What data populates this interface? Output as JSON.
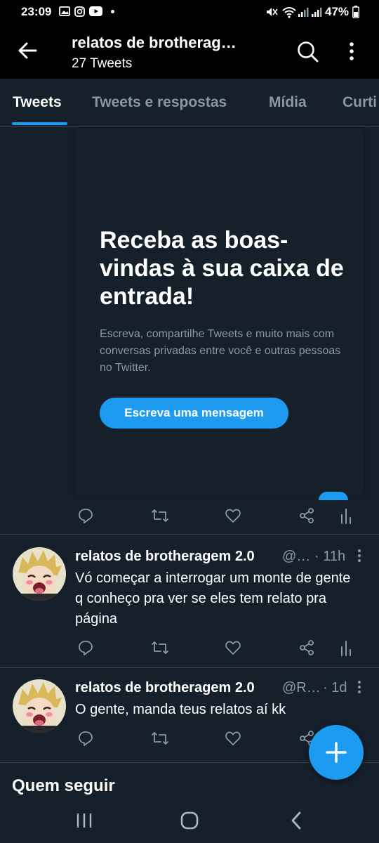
{
  "status_bar": {
    "time": "23:09",
    "battery": "47%",
    "left_icons": [
      "gallery-icon",
      "instagram-icon",
      "youtube-icon",
      "dot-icon"
    ],
    "right_icons": [
      "mute-icon",
      "wifi-icon",
      "signal-icon",
      "signal-icon",
      "battery-icon"
    ]
  },
  "header": {
    "title": "relatos de brotherag…",
    "subtitle": "27 Tweets",
    "icons": [
      "back-arrow-icon",
      "search-icon",
      "more-vertical-icon"
    ]
  },
  "tabs": [
    {
      "label": "Tweets",
      "active": true
    },
    {
      "label": "Tweets e respostas",
      "active": false
    },
    {
      "label": "Mídia",
      "active": false
    },
    {
      "label": "Curti",
      "active": false
    }
  ],
  "welcome_card": {
    "title": "Receba as boas-vindas à sua caixa de entrada!",
    "body": "Escreva, compartilhe Tweets e muito mais com conversas privadas entre você e outras pessoas no Twitter.",
    "button_label": "Escreva uma mensagem"
  },
  "tweets": [
    {
      "name": "relatos de brotheragem 2.0",
      "handle": "@…",
      "time": "· 11h",
      "text": "Vó começar a interrogar um monte de gente q conheço pra ver se eles tem relato pra página"
    },
    {
      "name": "relatos de brotheragem 2.0",
      "handle": "@R…",
      "time": "· 1d",
      "text": "O gente, manda teus relatos aí kk"
    }
  ],
  "tweet_action_icons": [
    "reply-icon",
    "retweet-icon",
    "like-icon",
    "share-icon",
    "analytics-icon"
  ],
  "section_title": "Quem seguir",
  "fab_icon": "plus-icon",
  "nav_icons": [
    "recent-apps-icon",
    "home-icon",
    "back-icon"
  ],
  "colors": {
    "background": "#15202b",
    "accent": "#1d9bf0",
    "secondary_text": "#8899a6",
    "divider": "#38444d"
  }
}
